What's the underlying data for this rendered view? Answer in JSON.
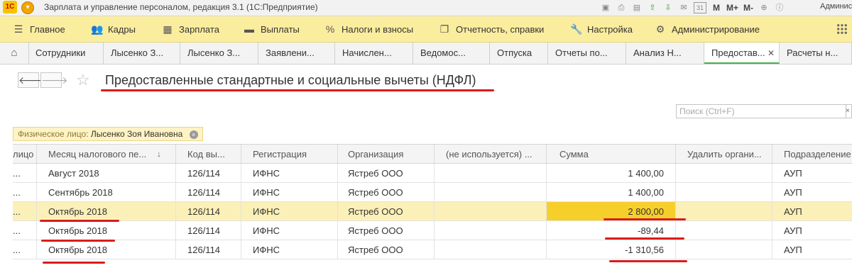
{
  "titlebar": {
    "logo_text": "1С",
    "menu_glyph": "▾",
    "title": "Зарплата и управление персоналом, редакция 3.1  (1С:Предприятие)",
    "icons": [
      "save-icon",
      "print-icon",
      "preview-icon",
      "upload-icon",
      "download-icon",
      "mail-icon",
      "calendar-icon"
    ],
    "calendar_label": "31",
    "memory_buttons": [
      "M",
      "M+",
      "M-"
    ],
    "zoom_icons": [
      "zoom-in-icon",
      "info-icon"
    ],
    "user": "Администратор"
  },
  "main_menu": [
    {
      "label": "Главное",
      "icon": "hamburger-icon",
      "glyph": "☰"
    },
    {
      "label": "Кадры",
      "icon": "people-icon",
      "glyph": "👥"
    },
    {
      "label": "Зарплата",
      "icon": "calculator-icon",
      "glyph": "▦"
    },
    {
      "label": "Выплаты",
      "icon": "wallet-icon",
      "glyph": "▬"
    },
    {
      "label": "Налоги и взносы",
      "icon": "percent-icon",
      "glyph": "%"
    },
    {
      "label": "Отчетность, справки",
      "icon": "report-icon",
      "glyph": "❐"
    },
    {
      "label": "Настройка",
      "icon": "wrench-icon",
      "glyph": "🔧"
    },
    {
      "label": "Администрирование",
      "icon": "gear-icon",
      "glyph": "⚙"
    }
  ],
  "tabs": [
    {
      "label": "Сотрудники"
    },
    {
      "label": "Лысенко З..."
    },
    {
      "label": "Лысенко З..."
    },
    {
      "label": "Заявлени..."
    },
    {
      "label": "Начислен..."
    },
    {
      "label": "Ведомос..."
    },
    {
      "label": "Отпуска"
    },
    {
      "label": "Отчеты по..."
    },
    {
      "label": "Анализ Н..."
    },
    {
      "label": "Предостав..."
    },
    {
      "label": "Расчеты н..."
    }
  ],
  "active_tab_index": 9,
  "form": {
    "back_glyph": "🡐",
    "forward_glyph": "🡒",
    "star_glyph": "☆",
    "title": "Предоставленные стандартные и социальные вычеты (НДФЛ)",
    "search_placeholder": "Поиск (Ctrl+F)",
    "search_more": "×"
  },
  "filter": {
    "label": "Физическое лицо:",
    "value": "Лысенко Зоя Ивановна",
    "clear_glyph": "×"
  },
  "table": {
    "columns": [
      "лицо",
      "Месяц налогового пе...",
      "Код вы...",
      "Регистрация",
      "Организация",
      "(не используется) ...",
      "Сумма",
      "Удалить органи...",
      "Подразделение"
    ],
    "sort_glyph": "↓",
    "rows": [
      {
        "person": "...",
        "month": "Август 2018",
        "code": "126/114",
        "registration": "ИФНС",
        "organization": "Ястреб ООО",
        "unused": "",
        "amount": "1 400,00",
        "delete_org": "",
        "division": "АУП"
      },
      {
        "person": "...",
        "month": "Сентябрь 2018",
        "code": "126/114",
        "registration": "ИФНС",
        "organization": "Ястреб ООО",
        "unused": "",
        "amount": "1 400,00",
        "delete_org": "",
        "division": "АУП"
      },
      {
        "person": "...",
        "month": "Октябрь 2018",
        "code": "126/114",
        "registration": "ИФНС",
        "organization": "Ястреб ООО",
        "unused": "",
        "amount": "2 800,00",
        "delete_org": "",
        "division": "АУП"
      },
      {
        "person": "...",
        "month": "Октябрь 2018",
        "code": "126/114",
        "registration": "ИФНС",
        "organization": "Ястреб ООО",
        "unused": "",
        "amount": "-89,44",
        "delete_org": "",
        "division": "АУП"
      },
      {
        "person": "...",
        "month": "Октябрь 2018",
        "code": "126/114",
        "registration": "ИФНС",
        "organization": "Ястреб ООО",
        "unused": "",
        "amount": "-1 310,56",
        "delete_org": "",
        "division": "АУП"
      }
    ],
    "selected_row_index": 2
  },
  "colors": {
    "menu_bg": "#fbed9e",
    "selected_row": "#fbf0b8",
    "amount_highlight": "#f7cf2b",
    "annotation_red": "#d91c1c",
    "active_tab_underline": "#4caf50"
  }
}
